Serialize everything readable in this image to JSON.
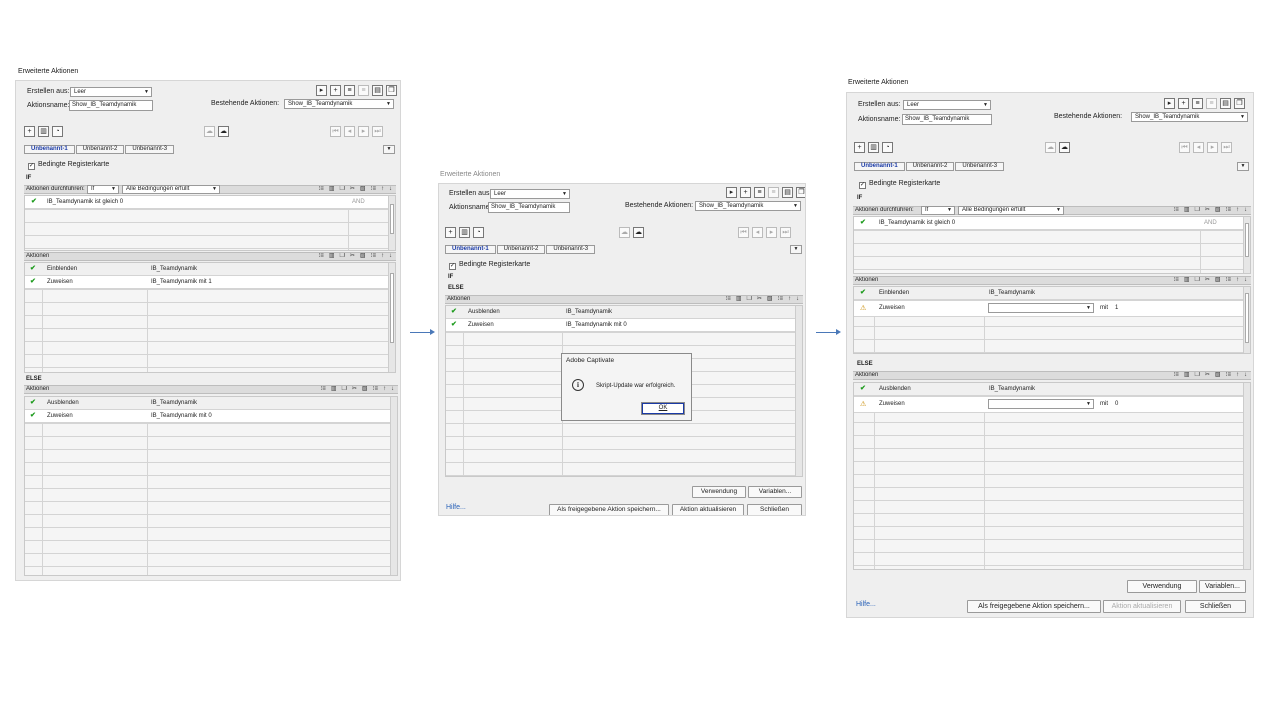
{
  "dialogs": [
    {
      "title": "Erweiterte Aktionen",
      "erstellen_label": "Erstellen aus:",
      "erstellen_value": "Leer",
      "aktionsname_label": "Aktionsname:",
      "aktionsname_value": "Show_IB_Teamdynamik",
      "bestehende_label": "Bestehende Aktionen:",
      "bestehende_value": "Show_IB_Teamdynamik",
      "tabs": [
        "Unbenannt-1",
        "Unbenannt-2",
        "Unbenannt-3"
      ],
      "bedingte_label": "Bedingte Registerkarte",
      "if_label": "IF",
      "else_label": "ELSE",
      "durchfuehren_label": "Aktionen durchführen:",
      "durchfuehren_value": "If",
      "bedingung_value": "Alle Bedingungen erfüllt",
      "cond_text": "IB_Teamdynamik   ist gleich   0",
      "and_label": "AND",
      "aktionen_label": "Aktionen",
      "if_actions": [
        {
          "action": "Einblenden",
          "target": "IB_Teamdynamik",
          "extra": ""
        },
        {
          "action": "Zuweisen",
          "target": "IB_Teamdynamik   mit   1",
          "extra": ""
        }
      ],
      "else_actions": [
        {
          "action": "Ausblenden",
          "target": "IB_Teamdynamik"
        },
        {
          "action": "Zuweisen",
          "target": "IB_Teamdynamik   mit   0"
        }
      ]
    },
    {
      "title": "Erweiterte Aktionen",
      "erstellen_label": "Erstellen aus:",
      "erstellen_value": "Leer",
      "aktionsname_label": "Aktionsname:",
      "aktionsname_value": "Show_IB_Teamdynamik",
      "bestehende_label": "Bestehende Aktionen:",
      "bestehende_value": "Show_IB_Teamdynamik",
      "tabs": [
        "Unbenannt-1",
        "Unbenannt-2",
        "Unbenannt-3"
      ],
      "bedingte_label": "Bedingte Registerkarte",
      "if_label": "IF",
      "else_label": "ELSE",
      "aktionen_label": "Aktionen",
      "else_actions": [
        {
          "action": "Ausblenden",
          "target": "IB_Teamdynamik"
        },
        {
          "action": "Zuweisen",
          "target": "IB_Teamdynamik   mit   0"
        }
      ],
      "verwendung": "Verwendung",
      "variablen": "Variablen...",
      "hilfe": "Hilfe...",
      "als_freigegeben": "Als freigegebene Aktion speichern...",
      "aktualisieren": "Aktion aktualisieren",
      "schliessen": "Schließen",
      "popup": {
        "title": "Adobe Captivate",
        "message": "Skript-Update war erfolgreich.",
        "ok": "OK"
      }
    },
    {
      "title": "Erweiterte Aktionen",
      "erstellen_label": "Erstellen aus:",
      "erstellen_value": "Leer",
      "aktionsname_label": "Aktionsname:",
      "aktionsname_value": "Show_IB_Teamdynamik",
      "bestehende_label": "Bestehende Aktionen:",
      "bestehende_value": "Show_IB_Teamdynamik",
      "tabs": [
        "Unbenannt-1",
        "Unbenannt-2",
        "Unbenannt-3"
      ],
      "bedingte_label": "Bedingte Registerkarte",
      "if_label": "IF",
      "else_label": "ELSE",
      "durchfuehren_label": "Aktionen durchführen:",
      "durchfuehren_value": "If",
      "bedingung_value": "Alle Bedingungen erfüllt",
      "cond_text": "IB_Teamdynamik   ist gleich   0",
      "and_label": "AND",
      "aktionen_label": "Aktionen",
      "if_actions": [
        {
          "action": "Einblenden",
          "target": "IB_Teamdynamik"
        },
        {
          "action": "Zuweisen",
          "mit": "mit",
          "value": "1"
        }
      ],
      "else_actions": [
        {
          "action": "Ausblenden",
          "target": "IB_Teamdynamik"
        },
        {
          "action": "Zuweisen",
          "mit": "mit",
          "value": "0"
        }
      ],
      "verwendung": "Verwendung",
      "variablen": "Variablen...",
      "hilfe": "Hilfe...",
      "als_freigegeben": "Als freigegebene Aktion speichern...",
      "aktualisieren": "Aktion aktualisieren",
      "schliessen": "Schließen"
    }
  ],
  "icons": {
    "check": "✔",
    "warn": "⚠",
    "dropdown": "▼",
    "add": "+",
    "delete": "🗑",
    "info": "i"
  }
}
